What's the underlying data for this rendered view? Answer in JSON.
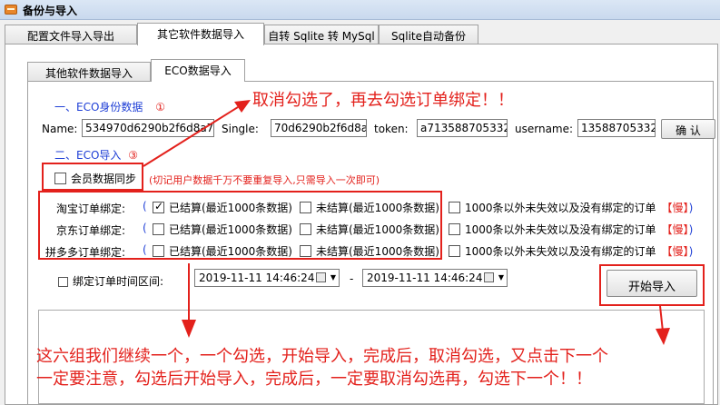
{
  "window": {
    "title": "备份与导入"
  },
  "main_tabs": [
    {
      "label": "配置文件导入导出"
    },
    {
      "label": "其它软件数据导入"
    },
    {
      "label": "自转 Sqlite 转 MySql"
    },
    {
      "label": "Sqlite自动备份"
    }
  ],
  "sub_tabs": [
    {
      "label": "其他软件数据导入"
    },
    {
      "label": "ECO数据导入"
    }
  ],
  "section1": {
    "title": "一、ECO身份数据",
    "marker": "①",
    "name_label": "Name:",
    "name_value": "534970d6290b2f6d8a7",
    "single_label": "Single:",
    "single_value": "70d6290b2f6d8a7",
    "token_label": "token:",
    "token_value": "a713588705332",
    "username_label": "username:",
    "username_value": "13588705332",
    "confirm_label": "确 认"
  },
  "section2": {
    "title": "二、ECO导入",
    "marker": "③",
    "member_sync_label": "会员数据同步",
    "member_sync_note": "(切记用户数据千万不要重复导入,只需导入一次即可)"
  },
  "binding_rows": [
    {
      "label": "淘宝订单绑定:",
      "settled": "已结算(最近1000条数据)",
      "settled_checked": true,
      "unsettled": "未结算(最近1000条数据)",
      "other": "1000条以外未失效以及没有绑定的订单",
      "slow": "【慢】"
    },
    {
      "label": "京东订单绑定:",
      "settled": "已结算(最近1000条数据)",
      "settled_checked": false,
      "unsettled": "未结算(最近1000条数据)",
      "other": "1000条以外未失效以及没有绑定的订单",
      "slow": "【慢】"
    },
    {
      "label": "拼多多订单绑定:",
      "settled": "已结算(最近1000条数据)",
      "settled_checked": false,
      "unsettled": "未结算(最近1000条数据)",
      "other": "1000条以外未失效以及没有绑定的订单",
      "slow": "【慢】"
    }
  ],
  "paren_open": "(",
  "paren_close": ")",
  "time_range": {
    "label": "绑定订单时间区间:",
    "start": "2019-11-11 14:46:24",
    "dash": "-",
    "end": "2019-11-11 14:46:24"
  },
  "start_import_label": "开始导入",
  "annotations": {
    "top": "取消勾选了，再去勾选订单绑定！！",
    "bottom_line1": "这六组我们继续一个，一个勾选，开始导入，完成后，取消勾选，又点击下一个",
    "bottom_line2": "一定要注意，勾选后开始导入，完成后，一定要取消勾选再，勾选下一个！！"
  },
  "colors": {
    "annotation_red": "#e3211c",
    "label_blue": "#1f3fd6",
    "slow_red": "#e3211c"
  }
}
